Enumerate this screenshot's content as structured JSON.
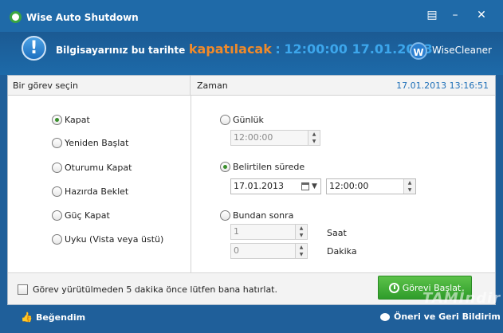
{
  "window": {
    "title": "Wise Auto Shutdown",
    "controls": {
      "menu": "▤",
      "minimize": "–",
      "close": "✕"
    }
  },
  "banner": {
    "prefix": "Bilgisayarınız bu tarihte",
    "action": "kapatılacak",
    "separator": ":",
    "schedule": "12:00:00 17.01.2013",
    "suffix": ".",
    "brand": "WiseCleaner",
    "brand_logo_letter": "W",
    "info_glyph": "!"
  },
  "left_panel": {
    "header": "Bir görev seçin",
    "tasks": [
      {
        "label": "Kapat",
        "checked": true
      },
      {
        "label": "Yeniden Başlat",
        "checked": false
      },
      {
        "label": "Oturumu Kapat",
        "checked": false
      },
      {
        "label": "Hazırda Beklet",
        "checked": false
      },
      {
        "label": "Güç Kapat",
        "checked": false
      },
      {
        "label": "Uyku (Vista veya üstü)",
        "checked": false
      }
    ]
  },
  "right_panel": {
    "header": "Zaman",
    "current_time": "17.01.2013 13:16:51",
    "daily": {
      "label": "Günlük",
      "checked": false,
      "time": "12:00:00"
    },
    "specified": {
      "label": "Belirtilen sürede",
      "checked": true,
      "date": "17.01.2013",
      "time": "12:00:00"
    },
    "after": {
      "label": "Bundan sonra",
      "checked": false,
      "hours_value": "1",
      "hours_unit": "Saat",
      "minutes_value": "0",
      "minutes_unit": "Dakika"
    }
  },
  "footer": {
    "reminder_label": "Görev yürütülmeden 5 dakika önce lütfen bana hatırlat.",
    "reminder_checked": false,
    "start_button": "Görevi Başlat"
  },
  "bottombar": {
    "like": "Beğendim",
    "feedback": "Öneri ve Geri Bildirim",
    "watermark": "TAMİndir"
  },
  "colors": {
    "titlebar": "#1f6aa8",
    "accent_orange": "#f08a2a",
    "accent_blue": "#3ca6ec",
    "start_green": "#3aa640"
  },
  "icons": {
    "app": "app-clock-icon",
    "info": "info-icon",
    "like": "thumbs-up-icon",
    "feedback": "speech-bubble-icon",
    "alarm": "alarm-clock-icon",
    "calendar": "calendar-icon"
  }
}
